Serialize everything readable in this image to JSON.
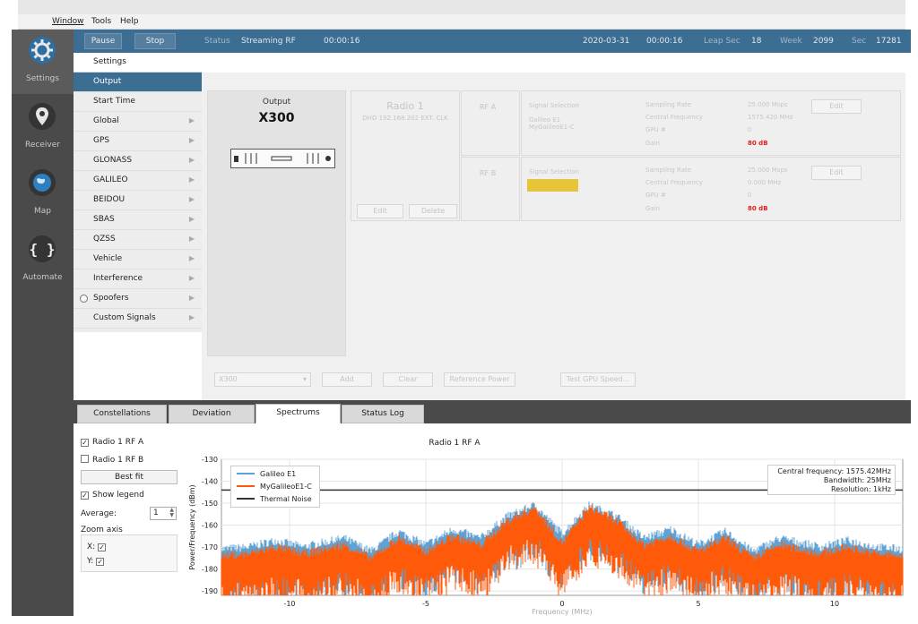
{
  "menu": [
    "Window",
    "Tools",
    "Help"
  ],
  "rail": [
    {
      "label": "Settings",
      "icon": "settings-gear-icon",
      "active": true
    },
    {
      "label": "Receiver",
      "icon": "location-pin-icon",
      "active": false
    },
    {
      "label": "Map",
      "icon": "globe-icon",
      "active": false
    },
    {
      "label": "Automate",
      "icon": "braces-icon",
      "active": false
    }
  ],
  "statusbar": {
    "pause": "Pause",
    "stop": "Stop",
    "status_label": "Status",
    "status_value": "Streaming RF",
    "elapsed": "00:00:16",
    "date": "2020-03-31",
    "time": "00:00:16",
    "leap_label": "Leap Sec",
    "leap_value": "18",
    "week_label": "Week",
    "week_value": "2099",
    "sec_label": "Sec",
    "sec_value": "17281"
  },
  "nav": [
    {
      "label": "Settings",
      "header": true
    },
    {
      "label": "Output",
      "selected": true
    },
    {
      "label": "Start Time"
    },
    {
      "label": "Global",
      "chev": true
    },
    {
      "label": "GPS",
      "chev": true
    },
    {
      "label": "GLONASS",
      "chev": true
    },
    {
      "label": "GALILEO",
      "chev": true
    },
    {
      "label": "BEIDOU",
      "chev": true
    },
    {
      "label": "SBAS",
      "chev": true
    },
    {
      "label": "QZSS",
      "chev": true
    },
    {
      "label": "Vehicle",
      "chev": true
    },
    {
      "label": "Interference",
      "chev": true
    },
    {
      "label": "Spoofers",
      "chev": true,
      "radio": true
    },
    {
      "label": "Custom Signals",
      "chev": true
    }
  ],
  "output": {
    "label": "Output",
    "model": "X300",
    "radio_title": "Radio 1",
    "radio_sub": "DHD 192.168.202 EXT. CLK",
    "edit": "Edit",
    "delete": "Delete",
    "rfa": {
      "name": "RF A",
      "sig_label": "Signal Selection",
      "sig_values": [
        "Galileo E1",
        "MyGalileoE1-C"
      ],
      "rows": [
        {
          "k": "Sampling Rate",
          "v": "25.000 Msps"
        },
        {
          "k": "Central Frequency",
          "v": "1575.420 MHz"
        },
        {
          "k": "GPU #",
          "v": "0"
        },
        {
          "k": "Gain",
          "v": "80 dB",
          "red": true
        }
      ],
      "edit": "Edit"
    },
    "rfb": {
      "name": "RF B",
      "sig_label": "Signal Selection",
      "rows": [
        {
          "k": "Sampling Rate",
          "v": "25.000 Msps"
        },
        {
          "k": "Central Frequency",
          "v": "0.000 MHz"
        },
        {
          "k": "GPU #",
          "v": "0"
        },
        {
          "k": "Gain",
          "v": "80 dB",
          "red": true
        }
      ],
      "edit": "Edit"
    },
    "bottom": {
      "select": "X300",
      "add": "Add",
      "clear": "Clear",
      "ref": "Reference Power",
      "test": "Test GPU Speed..."
    }
  },
  "tabs": [
    {
      "label": "Constellations"
    },
    {
      "label": "Deviation"
    },
    {
      "label": "Spectrums",
      "active": true
    },
    {
      "label": "Status Log"
    }
  ],
  "spectrum_controls": {
    "radio_a": "Radio 1 RF A",
    "radio_a_checked": true,
    "radio_b": "Radio 1 RF B",
    "radio_b_checked": false,
    "bestfit": "Best fit",
    "show_legend": "Show legend",
    "show_legend_checked": true,
    "average_label": "Average:",
    "average_value": "1",
    "zoom_label": "Zoom axis",
    "zoom_x": "X:",
    "zoom_y": "Y:"
  },
  "chart_data": {
    "type": "line",
    "title": "Radio 1 RF A",
    "ylabel": "Power/Frequency (dBm)",
    "xlabel": "Frequency (MHz)",
    "xlim": [
      -12.5,
      12.5
    ],
    "ylim": [
      -192,
      -130
    ],
    "xticks": [
      -10,
      -5,
      0,
      5,
      10
    ],
    "yticks": [
      -130,
      -140,
      -150,
      -160,
      -170,
      -180,
      -190
    ],
    "grid": true,
    "legend_position": "top-left",
    "series": [
      {
        "name": "Galileo E1",
        "color": "#5fa2d3",
        "x": [
          -12.5,
          -11.5,
          -10.5,
          -9.5,
          -8,
          -7,
          -6,
          -5,
          -4,
          -3,
          -2,
          -1,
          0,
          1,
          2,
          3,
          4,
          5,
          6,
          7,
          8,
          9.5,
          10.5,
          11.5,
          12.5
        ],
        "values": [
          -171,
          -170,
          -167,
          -170,
          -166,
          -172,
          -163,
          -169,
          -162,
          -166,
          -156,
          -151,
          -164,
          -151,
          -156,
          -166,
          -162,
          -169,
          -163,
          -172,
          -166,
          -170,
          -167,
          -170,
          -171
        ]
      },
      {
        "name": "MyGalileoE1-C",
        "color": "#ff5a0a",
        "x": [
          -12.5,
          -11.5,
          -10.5,
          -9.5,
          -8,
          -7,
          -6,
          -5,
          -4,
          -3,
          -2,
          -1,
          0,
          1,
          2,
          3,
          4,
          5,
          6,
          7,
          8,
          9.5,
          10.5,
          11.5,
          12.5
        ],
        "values": [
          -174,
          -173,
          -170,
          -173,
          -169,
          -175,
          -166,
          -172,
          -165,
          -169,
          -158,
          -152,
          -168,
          -152,
          -158,
          -169,
          -165,
          -172,
          -166,
          -175,
          -169,
          -173,
          -170,
          -173,
          -174
        ]
      },
      {
        "name": "Thermal Noise",
        "color": "#333333",
        "x": [
          -12.5,
          12.5
        ],
        "values": [
          -144,
          -144
        ]
      }
    ],
    "annotation": [
      "Central frequency: 1575.42MHz",
      "Bandwidth: 25MHz",
      "Resolution: 1kHz"
    ]
  }
}
